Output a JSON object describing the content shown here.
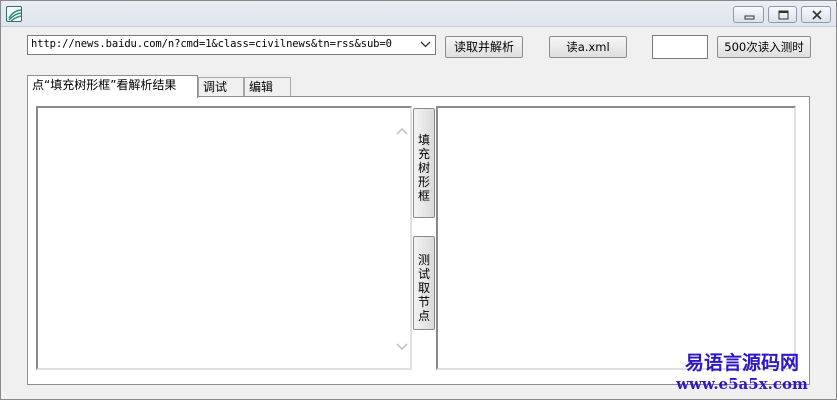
{
  "titlebar": {
    "icon": "app-icon",
    "buttons": [
      "minimize-icon",
      "restore-icon",
      "close-icon"
    ]
  },
  "toolbar": {
    "url_combo_value": "http://news.baidu.com/n?cmd=1&class=civilnews&tn=rss&sub=0",
    "parse_button": "读取并解析",
    "read_xml_button": "读a.xml",
    "count_input_value": "",
    "read500_button": "500次读入测时"
  },
  "tabs": [
    {
      "label": "点“填充树形框”看解析结果",
      "active": true
    },
    {
      "label": "调试",
      "active": false
    },
    {
      "label": "编辑",
      "active": false
    }
  ],
  "panel": {
    "fill_tree_button": "填充树形框",
    "test_node_button": "测试取节点"
  },
  "watermark": {
    "line1": "易语言源码网",
    "line2": "www.e5a5x.com"
  },
  "colors": {
    "watermark": "#2d17c8",
    "window_bg": "#f0f0f0"
  }
}
